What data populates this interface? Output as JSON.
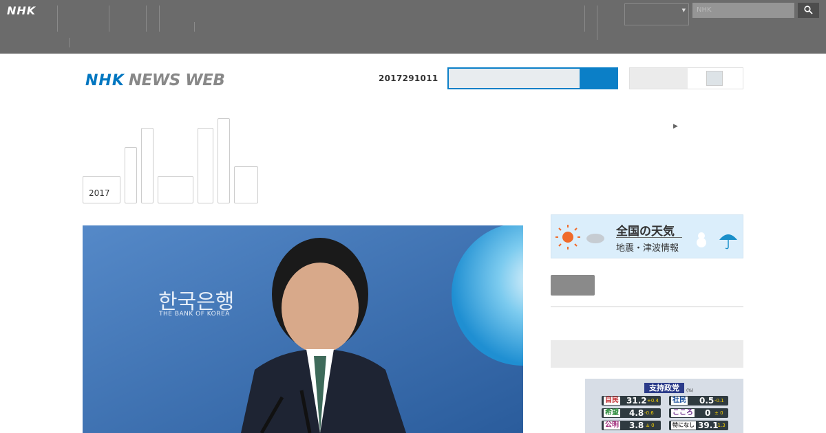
{
  "global_bar": {
    "logo": "NHK",
    "nav_items": [],
    "language_select": "",
    "search_placeholder": "NHK"
  },
  "header": {
    "logo_nhk": "NHK",
    "logo_text": "NEWS WEB",
    "date": "2017291011"
  },
  "tabs": {
    "election_label": "2017"
  },
  "right_link": "",
  "weather_banner": {
    "title": "全国の天気",
    "subtitle": "地震・津波情報"
  },
  "right_link_2": "",
  "side_box_title": "",
  "hero": {
    "korean_text": "한국은행",
    "english_text": "THE BANK OF KOREA"
  },
  "poll_graphic": {
    "title": "支持政党",
    "unit": "(%)",
    "rows": [
      {
        "party": "自民",
        "value": "31.2",
        "diff": "+0.4"
      },
      {
        "party": "社民",
        "value": "0.5",
        "diff": "-0.1"
      },
      {
        "party": "希望",
        "value": "4.8",
        "diff": "-0.6"
      },
      {
        "party": "こころ",
        "value": "0",
        "diff": "± 0"
      },
      {
        "party": "公明",
        "value": "3.8",
        "diff": "± 0"
      },
      {
        "party": "特になし",
        "value": "39.1",
        "diff": "-1.3"
      }
    ]
  },
  "colors": {
    "global_bar": "#6b6b6b",
    "brand_blue": "#0076c0",
    "link_blue": "#005d98"
  }
}
